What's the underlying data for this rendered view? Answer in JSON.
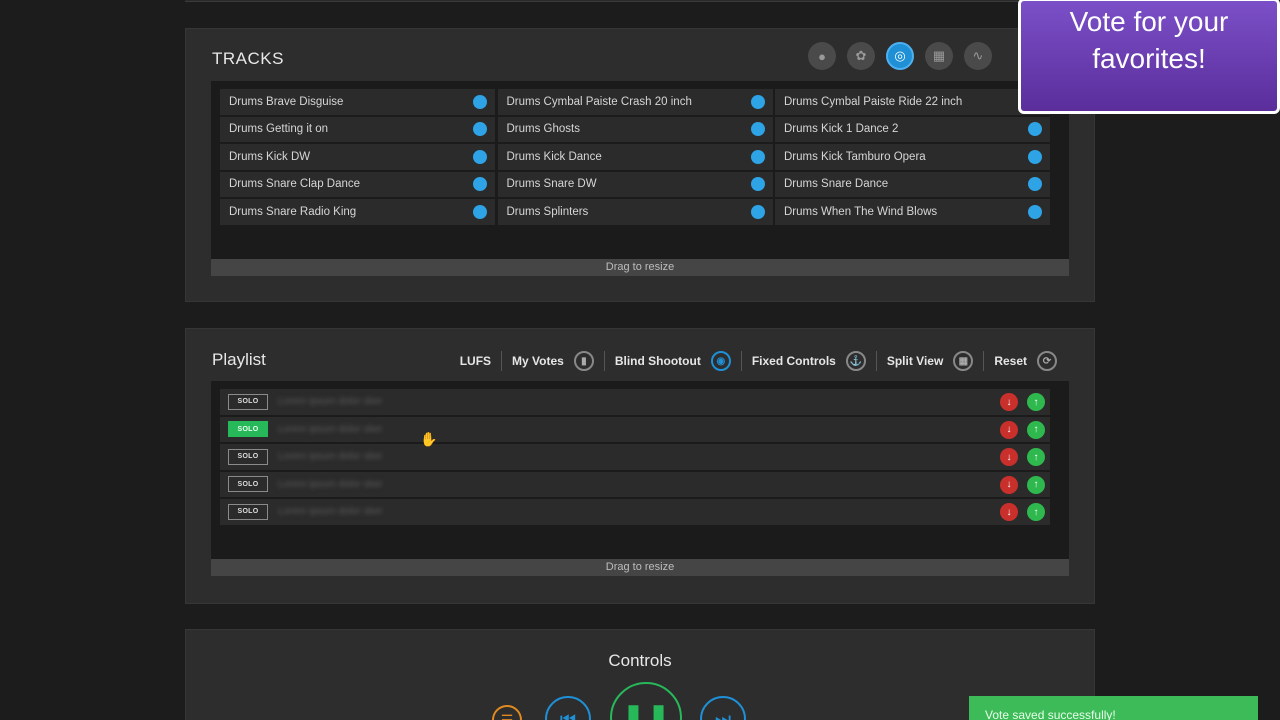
{
  "tracks": {
    "title": "TRACKS",
    "filter_icons": [
      "microphone-icon",
      "bug-icon",
      "drum-icon",
      "piano-icon",
      "waveform-icon"
    ],
    "items": [
      "Drums Brave Disguise",
      "Drums Cymbal Paiste Crash 20 inch",
      "Drums Cymbal Paiste Ride 22 inch",
      "Drums Getting it on",
      "Drums Ghosts",
      "Drums Kick 1 Dance 2",
      "Drums Kick DW",
      "Drums Kick Dance",
      "Drums Kick Tamburo Opera",
      "Drums Snare Clap Dance",
      "Drums Snare DW",
      "Drums Snare Dance",
      "Drums Snare Radio King",
      "Drums Splinters",
      "Drums When The Wind Blows"
    ],
    "resize_label": "Drag to resize"
  },
  "playlist": {
    "title": "Playlist",
    "toolbar": {
      "lufs": "LUFS",
      "my_votes": "My Votes",
      "blind_shootout": "Blind Shootout",
      "fixed_controls": "Fixed Controls",
      "split_view": "Split View",
      "reset": "Reset"
    },
    "solo_label": "SOLO",
    "blurred_name": "Lorem ipsum dolor sker",
    "rows": [
      {
        "solo_active": false
      },
      {
        "solo_active": true
      },
      {
        "solo_active": false
      },
      {
        "solo_active": false
      },
      {
        "solo_active": false
      }
    ],
    "resize_label": "Drag to resize"
  },
  "controls": {
    "title": "Controls"
  },
  "banner": {
    "line1": "Vote for your",
    "line2": "favorites!"
  },
  "toast": {
    "message": "Vote saved successfully!"
  },
  "colors": {
    "accent_blue": "#1f8fd6",
    "accent_green": "#27b85a",
    "vote_down": "#c9302c",
    "banner_purple": "#6a3db5"
  }
}
